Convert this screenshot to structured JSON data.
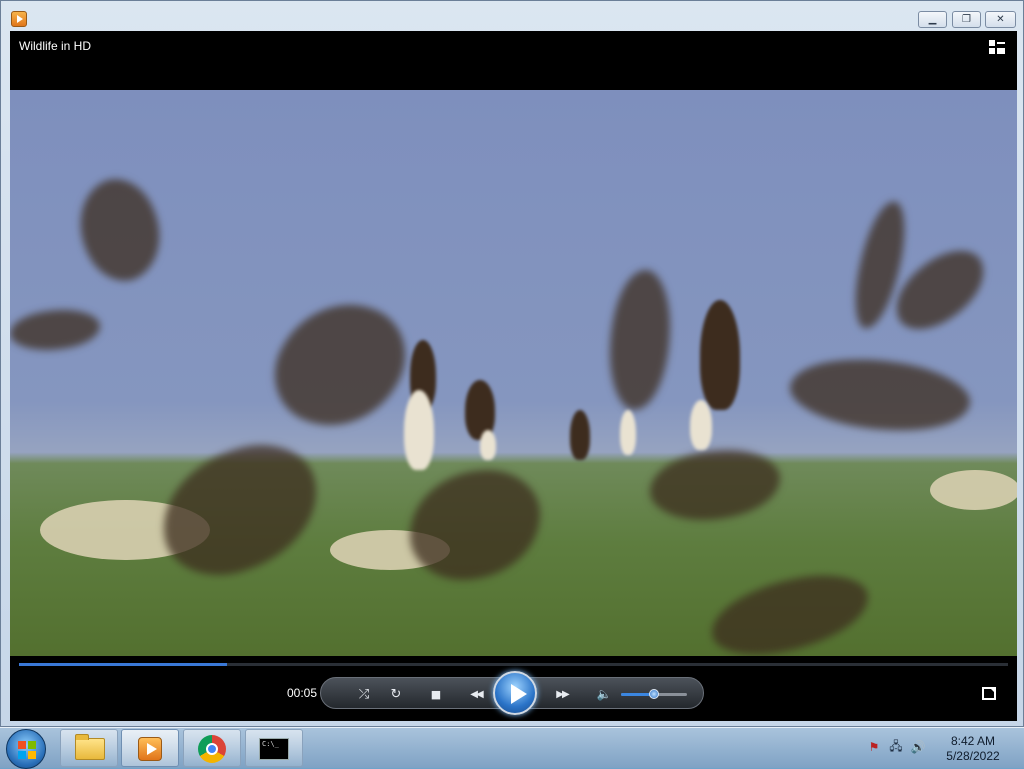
{
  "window": {
    "title": "Wildlife in HD",
    "controls": {
      "minimize_icon": "minimize-icon",
      "maximize_icon": "restore-icon",
      "close_icon": "close-icon"
    }
  },
  "player": {
    "time_elapsed": "00:05",
    "seek_progress": 0.21,
    "volume_level": 0.5,
    "controls": [
      "shuffle-icon",
      "repeat-icon",
      "stop-icon",
      "previous-icon",
      "play-icon",
      "next-icon",
      "volume-icon"
    ],
    "glyphs": {
      "shuffle": "⤮",
      "repeat": "↻",
      "stop": "■",
      "previous": "◀◀",
      "next": "▶▶",
      "volume": "🔈",
      "minimize": "▁",
      "maximize": "❐",
      "close": "✕"
    }
  },
  "taskbar": {
    "items": [
      {
        "name": "Windows Explorer",
        "icon": "folder-icon"
      },
      {
        "name": "Windows Media Player",
        "icon": "wmp-icon",
        "active": true
      },
      {
        "name": "Google Chrome",
        "icon": "chrome-icon"
      },
      {
        "name": "Command Prompt",
        "icon": "cmd-icon",
        "icon_text": "C:\\_"
      }
    ],
    "tray": {
      "icons": [
        "flag-icon",
        "network-icon",
        "speaker-icon"
      ],
      "glyphs": [
        "⚑",
        "🖧",
        "🔊"
      ]
    },
    "clock": {
      "time": "8:42 AM",
      "date": "5/28/2022"
    }
  },
  "colors": {
    "accent": "#3a78d6",
    "taskbar": "#8fb0cf",
    "player_bg": "#000000"
  }
}
